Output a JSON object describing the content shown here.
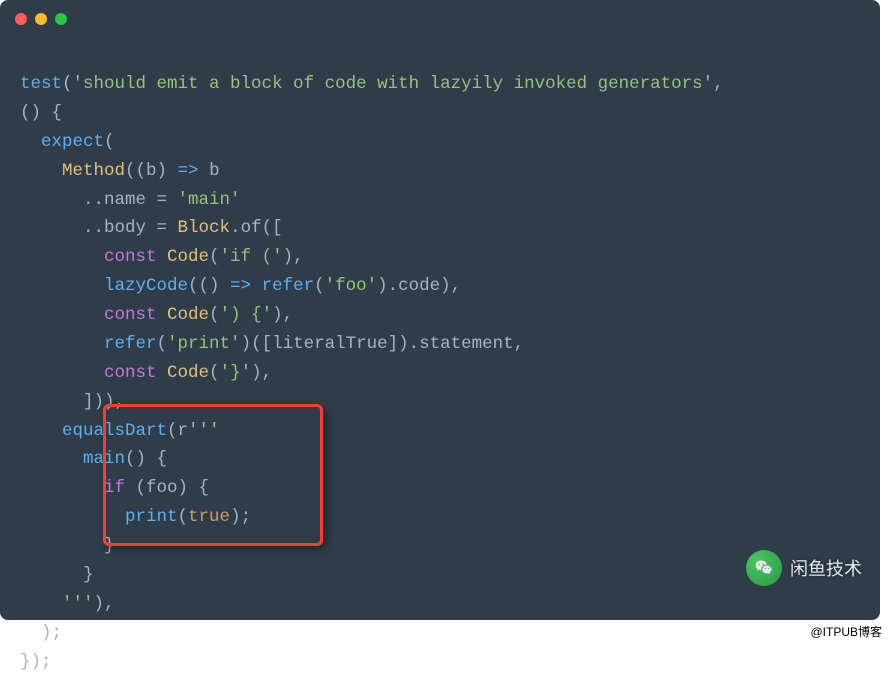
{
  "code": {
    "l1a": "test",
    "l1b": "(",
    "l1c": "'should emit a block of code with lazyily invoked generators'",
    "l1d": ",",
    "l2a": "() {",
    "l3a": "  expect",
    "l3b": "(",
    "l4a": "    Method",
    "l4b": "((b) ",
    "l4c": "=>",
    "l4d": " b",
    "l5a": "      ..name ",
    "l5b": "= ",
    "l5c": "'main'",
    "l6a": "      ..body ",
    "l6b": "= ",
    "l6c": "Block",
    "l6d": ".of([",
    "l7a": "        ",
    "l7b": "const",
    "l7c": " Code",
    "l7d": "(",
    "l7e": "'if ('",
    "l7f": "),",
    "l8a": "        lazyCode",
    "l8b": "(() ",
    "l8c": "=>",
    "l8d": " refer",
    "l8e": "(",
    "l8f": "'foo'",
    "l8g": ").code),",
    "l9a": "        ",
    "l9b": "const",
    "l9c": " Code",
    "l9d": "(",
    "l9e": "') {'",
    "l9f": "),",
    "l10a": "        refer",
    "l10b": "(",
    "l10c": "'print'",
    "l10d": ")([literalTrue]).statement,",
    "l11a": "        ",
    "l11b": "const",
    "l11c": " Code",
    "l11d": "(",
    "l11e": "'}'",
    "l11f": "),",
    "l12a": "      ])),",
    "l13a": "    equalsDart",
    "l13b": "(r",
    "l13c": "'''",
    "l14a": "      main",
    "l14b": "() {",
    "l15a": "        ",
    "l15b": "if",
    "l15c": " (foo) {",
    "l16a": "          print",
    "l16b": "(",
    "l16c": "true",
    "l16d": ");",
    "l17a": "        }",
    "l18a": "      }",
    "l19a": "    '''",
    "l19b": "),",
    "l20a": "  );",
    "l21a": "});"
  },
  "watermark": "闲鱼技术",
  "footnote": "@ITPUB博客"
}
